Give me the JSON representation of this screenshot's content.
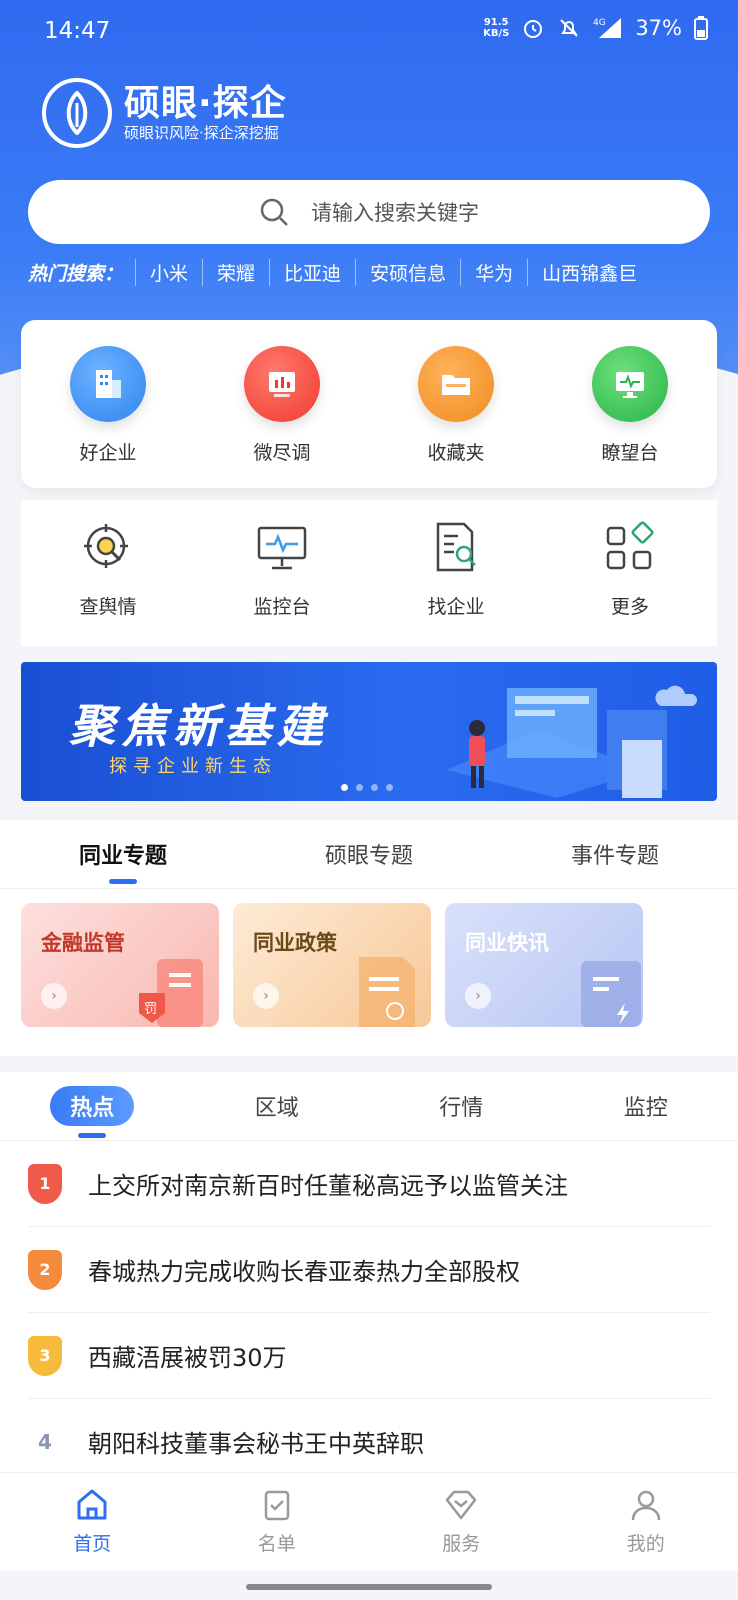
{
  "status": {
    "time": "14:47",
    "net_speed": "91.5",
    "net_unit": "KB/S",
    "battery": "37%",
    "signal": "4G"
  },
  "brand": {
    "title": "硕眼·探企",
    "subtitle": "硕眼识风险·探企深挖掘"
  },
  "search": {
    "placeholder": "请输入搜索关键字"
  },
  "hot": {
    "title": "热门搜索：",
    "items": [
      "小米",
      "荣耀",
      "比亚迪",
      "安硕信息",
      "华为",
      "山西锦鑫巨"
    ]
  },
  "quick": [
    {
      "label": "好企业",
      "icon": "building-icon",
      "color": "#2f84f0"
    },
    {
      "label": "微尽调",
      "icon": "chart-icon",
      "color": "#f03a2e"
    },
    {
      "label": "收藏夹",
      "icon": "folder-icon",
      "color": "#f08c20"
    },
    {
      "label": "瞭望台",
      "icon": "monitor-icon",
      "color": "#28b34a"
    }
  ],
  "tools": [
    {
      "label": "查舆情",
      "icon": "target-search-icon"
    },
    {
      "label": "监控台",
      "icon": "monitor-icon"
    },
    {
      "label": "找企业",
      "icon": "document-search-icon"
    },
    {
      "label": "更多",
      "icon": "grid-icon"
    }
  ],
  "banner": {
    "title": "聚焦新基建",
    "subtitle": "探寻企业新生态"
  },
  "topic_tabs": [
    "同业专题",
    "硕眼专题",
    "事件专题"
  ],
  "topic_cards": [
    {
      "title": "金融监管",
      "badge": "罚",
      "color_from": "#fde0de",
      "color_to": "#f9b7b0",
      "text_color": "#c0392b"
    },
    {
      "title": "同业政策",
      "badge": "",
      "color_from": "#fdebd6",
      "color_to": "#f7c897",
      "text_color": "#6b4a1a"
    },
    {
      "title": "同业快讯",
      "badge": "",
      "color_from": "#d8e1fb",
      "color_to": "#b9c6f3",
      "text_color": "#ffffff"
    }
  ],
  "news_tabs": [
    "热点",
    "区域",
    "行情",
    "监控"
  ],
  "news": [
    {
      "rank": "1",
      "text": "上交所对南京新百时任董秘高远予以监管关注",
      "color": "#f05a4a"
    },
    {
      "rank": "2",
      "text": "春城热力完成收购长春亚泰热力全部股权",
      "color": "#f38a3c"
    },
    {
      "rank": "3",
      "text": "西藏浯展被罚30万",
      "color": "#f6bb3a"
    },
    {
      "rank": "4",
      "text": "朝阳科技董事会秘书王中英辞职",
      "color": ""
    }
  ],
  "bottom_nav": [
    {
      "label": "首页",
      "icon": "home-icon"
    },
    {
      "label": "名单",
      "icon": "checklist-icon"
    },
    {
      "label": "服务",
      "icon": "diamond-icon"
    },
    {
      "label": "我的",
      "icon": "person-icon"
    }
  ]
}
